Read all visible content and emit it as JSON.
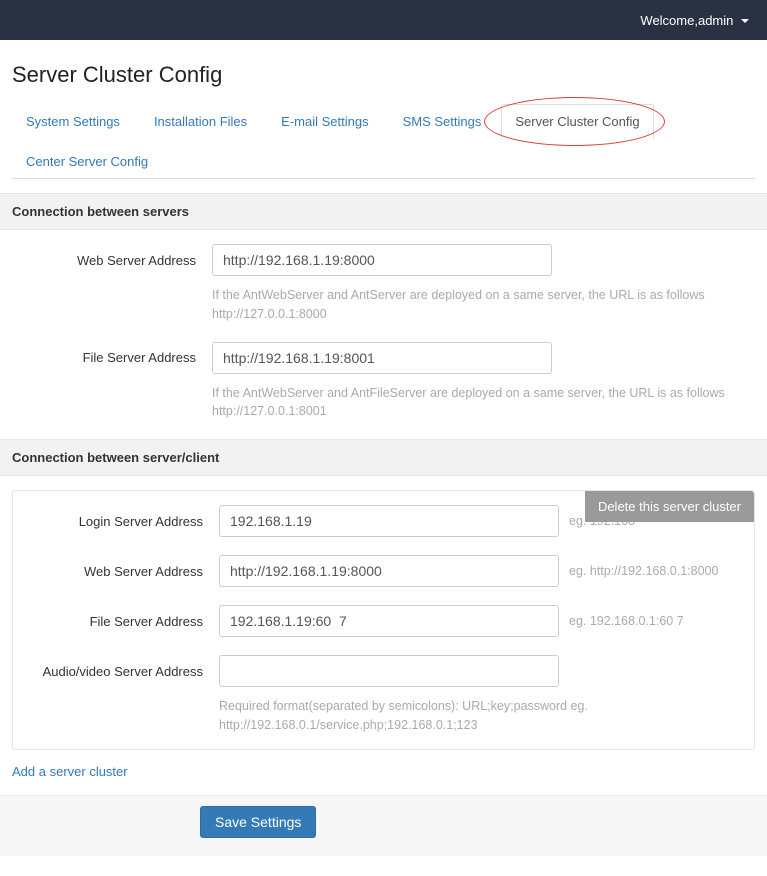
{
  "topbar": {
    "welcome": "Welcome,admin"
  },
  "page_title": "Server Cluster Config",
  "tabs": [
    {
      "label": "System Settings",
      "active": false
    },
    {
      "label": "Installation Files",
      "active": false
    },
    {
      "label": "E-mail Settings",
      "active": false
    },
    {
      "label": "SMS Settings",
      "active": false
    },
    {
      "label": "Server Cluster Config",
      "active": true
    },
    {
      "label": "Center Server Config",
      "active": false
    }
  ],
  "section_servers": {
    "title": "Connection between servers",
    "web_address_label": "Web Server Address",
    "web_address_value": "http://192.168.1.19:8000",
    "web_address_hint": "If the AntWebServer and AntServer are deployed on a same server, the URL is as follows http://127.0.0.1:8000",
    "file_address_label": "File Server Address",
    "file_address_value": "http://192.168.1.19:8001",
    "file_address_hint": "If the AntWebServer and AntFileServer are deployed on a same server, the URL is as follows http://127.0.0.1:8001"
  },
  "section_client": {
    "title": "Connection between server/client",
    "delete_button": "Delete this server cluster",
    "login_label": "Login Server Address",
    "login_value": "192.168.1.19",
    "login_hint": "eg. 192.168",
    "web_label": "Web Server Address",
    "web_value": "http://192.168.1.19:8000",
    "web_hint": "eg. http://192.168.0.1:8000",
    "file_label": "File Server Address",
    "file_value": "192.168.1.19:60  7",
    "file_hint": "eg. 192.168.0.1:60  7",
    "av_label": "Audio/video Server Address",
    "av_value": "",
    "av_hint": "Required format(separated by semicolons): URL;key;password eg. http://192.168.0.1/service.php;192.168.0.1;123",
    "add_link": "Add a server cluster"
  },
  "save_button": "Save Settings"
}
